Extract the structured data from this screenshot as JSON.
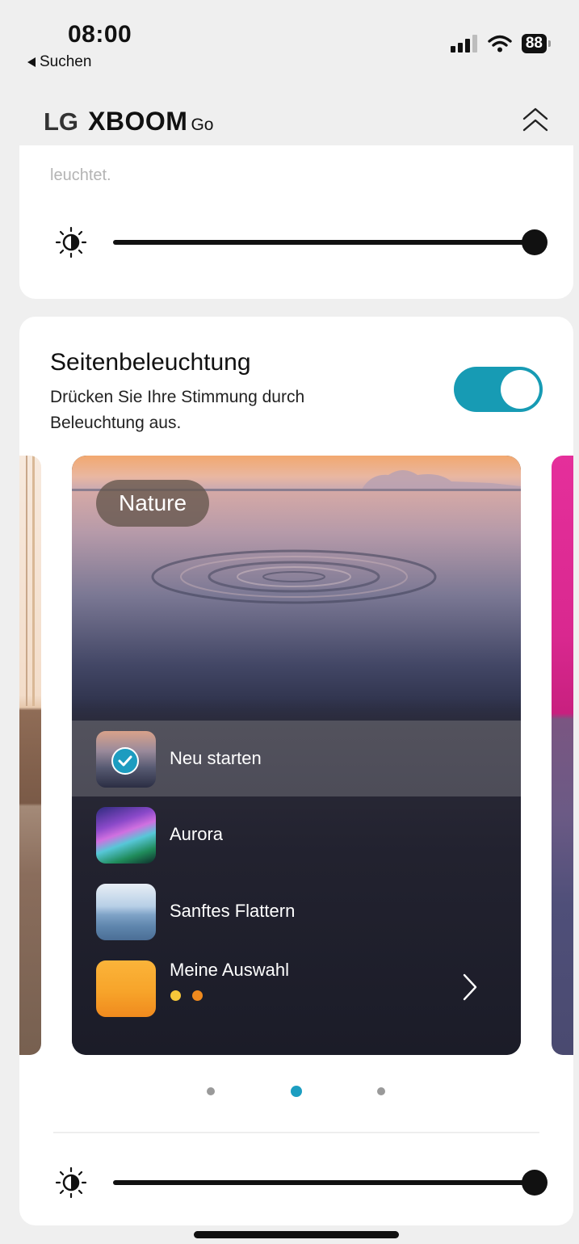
{
  "status_bar": {
    "time": "08:00",
    "back_label": "Suchen",
    "battery": "88"
  },
  "header": {
    "brand_lg": "LG",
    "brand_xboom": "XBOOM",
    "brand_go": "Go"
  },
  "top_card": {
    "faded_text": "leuchtet.",
    "brightness_level": 1.0
  },
  "lighting": {
    "title": "Seitenbeleuchtung",
    "description": "Drücken Sie Ihre Stimmung durch Beleuchtung aus.",
    "toggle_on": true,
    "preset_badge": "Nature",
    "items": [
      {
        "label": "Neu starten",
        "selected": true
      },
      {
        "label": "Aurora",
        "selected": false
      },
      {
        "label": "Sanftes Flattern",
        "selected": false
      },
      {
        "label": "Meine Auswahl",
        "selected": false
      }
    ],
    "custom_dot_colors": [
      "#f7c83a",
      "#f08a1e"
    ],
    "toggle_color": "#179bb4",
    "pager": {
      "count": 3,
      "active_index": 1
    },
    "brightness_level": 1.0
  }
}
